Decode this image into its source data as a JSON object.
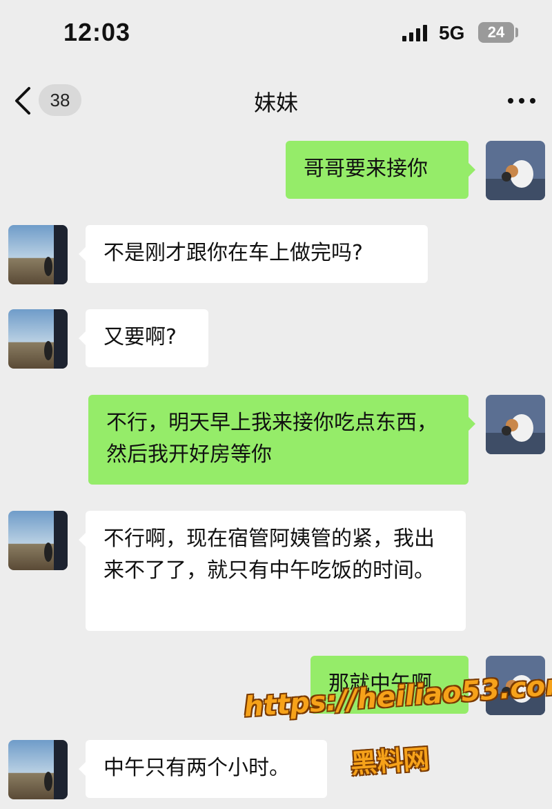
{
  "status_bar": {
    "time": "12:03",
    "network": "5G",
    "battery": "24"
  },
  "header": {
    "unread_count": "38",
    "title": "妹妹"
  },
  "messages": [
    {
      "sender": "me",
      "text": "哥哥要来接你"
    },
    {
      "sender": "contact",
      "text": "不是刚才跟你在车上做完吗?"
    },
    {
      "sender": "contact",
      "text": "又要啊?"
    },
    {
      "sender": "me",
      "text": "不行，明天早上我来接你吃点东西，然后我开好房等你"
    },
    {
      "sender": "contact",
      "text": "不行啊，现在宿管阿姨管的紧，我出来不了了，就只有中午吃饭的时间。"
    },
    {
      "sender": "me",
      "text": "那就中午啊"
    },
    {
      "sender": "contact",
      "text": "中午只有两个小时。"
    }
  ],
  "watermark": {
    "url": "https://heiliao53.com",
    "site": "黑料网"
  },
  "colors": {
    "background": "#ededed",
    "outgoing_bubble": "#95ec69",
    "incoming_bubble": "#ffffff",
    "watermark": "#f6a21a"
  }
}
